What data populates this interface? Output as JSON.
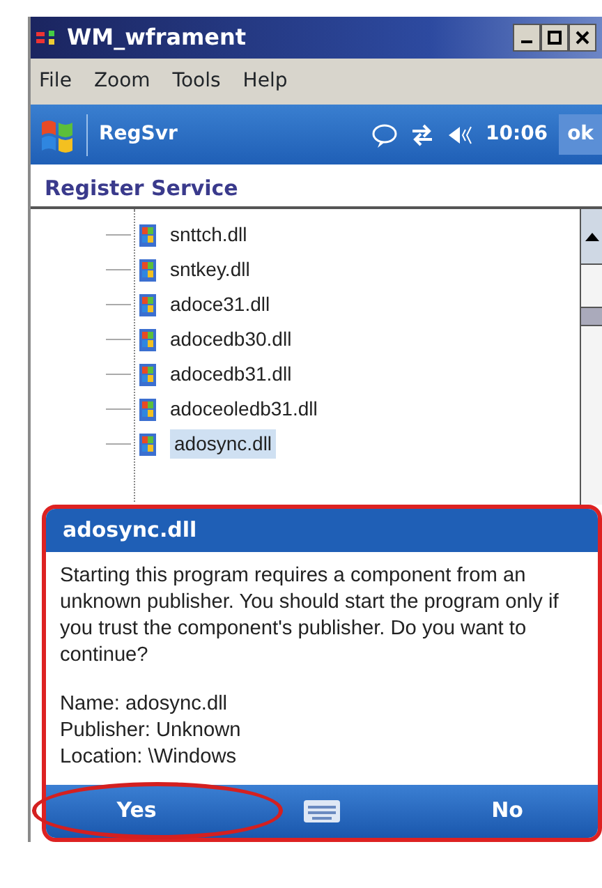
{
  "window": {
    "title": "WM_wframent"
  },
  "menu": [
    "File",
    "Zoom",
    "Tools",
    "Help"
  ],
  "navbar": {
    "app": "RegSvr",
    "time": "10:06",
    "ok": "ok"
  },
  "heading": "Register Service",
  "tree_items": [
    {
      "label": "snttch.dll",
      "selected": false
    },
    {
      "label": "sntkey.dll",
      "selected": false
    },
    {
      "label": "adoce31.dll",
      "selected": false
    },
    {
      "label": "adocedb30.dll",
      "selected": false
    },
    {
      "label": "adocedb31.dll",
      "selected": false
    },
    {
      "label": "adoceoledb31.dll",
      "selected": false
    },
    {
      "label": "adosync.dll",
      "selected": true
    }
  ],
  "dialog": {
    "title": "adosync.dll",
    "message": "Starting this program requires a component from an unknown publisher. You should start the program only if you trust the component's publisher. Do you want to continue?",
    "details": [
      "Name: adosync.dll",
      "Publisher: Unknown",
      "Location: \\Windows"
    ],
    "softkeys": [
      {
        "label": "Yes",
        "circled": true
      },
      {
        "label": "No",
        "circled": false
      }
    ]
  }
}
